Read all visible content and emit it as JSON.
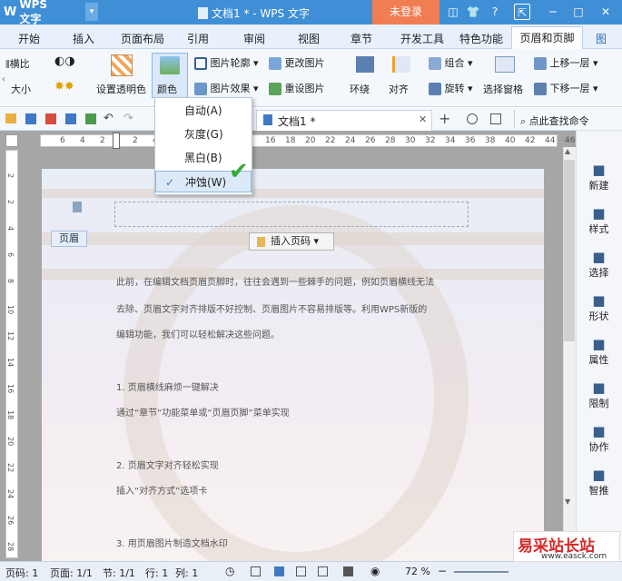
{
  "app": {
    "name": "WPS 文字",
    "dropdown": "▾",
    "window_title": "文档1 * - WPS 文字",
    "login": "未登录",
    "controls": [
      "◫",
      "👕",
      "?",
      "⇱",
      "─",
      "□",
      "✕"
    ]
  },
  "tabs": [
    "开始",
    "插入",
    "页面布局",
    "引用",
    "审阅",
    "视图",
    "章节",
    "开发工具",
    "特色功能",
    "页眉和页脚",
    "图"
  ],
  "ribbon": {
    "horiz_flip": "横比",
    "size": "大小",
    "set_transparent": "设置透明色",
    "color": "颜色",
    "pic_outline": "图片轮廓",
    "change_pic": "更改图片",
    "pic_effect": "图片效果",
    "reset_pic": "重设图片",
    "wrap": "环绕",
    "align": "对齐",
    "group": "组合",
    "rotate": "旋转",
    "selection_pane": "选择窗格",
    "bring_forward": "上移一层",
    "send_backward": "下移一层"
  },
  "qat": {
    "doc_tab": "文档1 *",
    "close": "✕",
    "add": "+",
    "search": "点此查找命令"
  },
  "ruler": {
    "h_ticks": [
      "6",
      "4",
      "2",
      "2",
      "4",
      "6",
      "8",
      "16",
      "18",
      "20",
      "22",
      "24",
      "26",
      "28",
      "30",
      "32",
      "34",
      "36",
      "38",
      "40",
      "42",
      "44",
      "46"
    ],
    "v_ticks": [
      "2",
      "2",
      "4",
      "6",
      "8",
      "10",
      "12",
      "14",
      "16",
      "18",
      "20",
      "22",
      "24",
      "26",
      "28"
    ]
  },
  "document": {
    "header_label": "页眉",
    "insert_page_number": "插入页码",
    "paragraphs": [
      "此前，在编辑文档页眉页脚时，往往会遇到一些棘手的问题，例如页眉横线无法",
      "去除、页眉文字对齐排版不好控制、页眉图片不容易排版等。利用WPS新版的",
      "编辑功能，我们可以轻松解决这些问题。",
      "1. 页眉横线麻烦一键解决",
      "通过“章节”功能菜单或“页眉页脚”菜单实现",
      "2. 页眉文字对齐轻松实现",
      "插入“对齐方式”选项卡",
      "3. 用页眉图片制造文档水印"
    ]
  },
  "color_menu": {
    "items": [
      "自动(A)",
      "灰度(G)",
      "黑白(B)",
      "冲蚀(W)"
    ],
    "checked_index": 3
  },
  "side_panel": [
    {
      "icon": "new-icon",
      "label": "新建"
    },
    {
      "icon": "style-icon",
      "label": "样式"
    },
    {
      "icon": "select-icon",
      "label": "选择"
    },
    {
      "icon": "shape-icon",
      "label": "形状"
    },
    {
      "icon": "property-icon",
      "label": "属性"
    },
    {
      "icon": "restrict-icon",
      "label": "限制"
    },
    {
      "icon": "collab-icon",
      "label": "协作"
    },
    {
      "icon": "smart-icon",
      "label": "智推"
    }
  ],
  "status": {
    "page": "页码: 1",
    "pages": "页面: 1/1",
    "section": "节: 1/1",
    "row": "行: 1",
    "col": "列: 1",
    "zoom": "72 %"
  },
  "watermark": {
    "text": "易采站长站",
    "url": "www.easck.com"
  },
  "colors": {
    "title_bg": "#3f8fd6",
    "login_bg": "#f17d52",
    "accent": "#3f8fd6",
    "check": "#3aa93a"
  }
}
